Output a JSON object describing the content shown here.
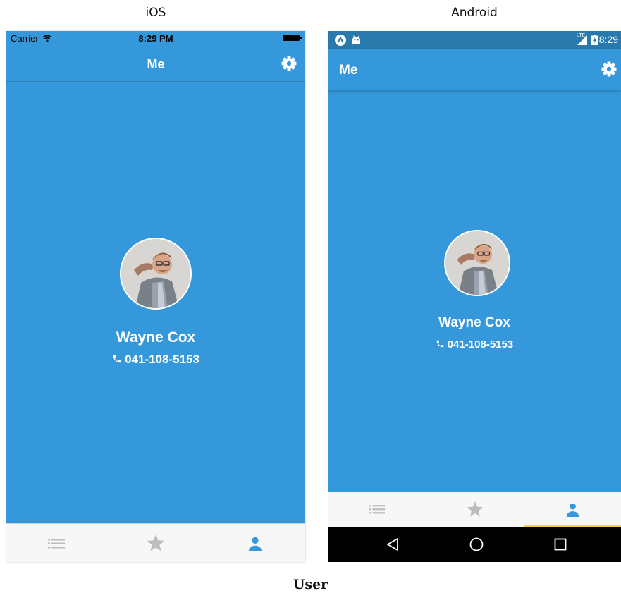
{
  "labels": {
    "ios": "iOS",
    "android": "Android",
    "caption": "User"
  },
  "ios": {
    "status": {
      "carrier": "Carrier",
      "time": "8:29 PM"
    },
    "nav_title": "Me",
    "profile": {
      "name": "Wayne Cox",
      "phone": "041-108-5153"
    },
    "tabs": [
      {
        "icon": "list-icon",
        "active": false
      },
      {
        "icon": "star-icon",
        "active": false
      },
      {
        "icon": "person-icon",
        "active": true
      }
    ]
  },
  "android": {
    "status": {
      "network": "LTE",
      "time": "8:29"
    },
    "nav_title": "Me",
    "profile": {
      "name": "Wayne Cox",
      "phone": "041-108-5153"
    },
    "tabs": [
      {
        "icon": "list-icon",
        "active": false
      },
      {
        "icon": "star-icon",
        "active": false
      },
      {
        "icon": "person-icon",
        "active": true
      }
    ],
    "system_nav": [
      "back-icon",
      "home-icon",
      "recents-icon"
    ]
  },
  "colors": {
    "primary": "#3498db",
    "inactive": "#bdbdbd",
    "tab_background": "#f7f7f7",
    "indicator": "#f6d14b"
  }
}
